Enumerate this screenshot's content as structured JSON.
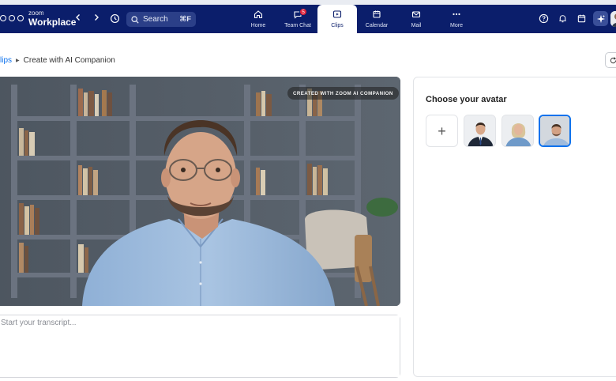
{
  "app": {
    "brand_small": "zoom",
    "brand_large": "Workplace"
  },
  "search": {
    "placeholder": "Search",
    "shortcut": "⌘F"
  },
  "nav_tabs": [
    {
      "label": "Home",
      "icon": "home-icon"
    },
    {
      "label": "Team Chat",
      "icon": "chat-icon",
      "badge": "5"
    },
    {
      "label": "Clips",
      "icon": "clips-icon",
      "active": true
    },
    {
      "label": "Calendar",
      "icon": "calendar-icon"
    },
    {
      "label": "Mail",
      "icon": "mail-icon"
    },
    {
      "label": "More",
      "icon": "more-icon"
    }
  ],
  "breadcrumb": {
    "parent": "Clips",
    "parent_visible": "lips",
    "current": "Create with AI Companion"
  },
  "video": {
    "watermark": "CREATED WITH ZOOM AI COMPANION"
  },
  "transcript": {
    "placeholder": "Start your transcript..."
  },
  "avatar_panel": {
    "title": "Choose your avatar",
    "options": [
      {
        "name": "add-avatar",
        "label": "+"
      },
      {
        "name": "avatar-man-suit"
      },
      {
        "name": "avatar-woman-blonde"
      },
      {
        "name": "avatar-man-glasses",
        "selected": true
      }
    ]
  },
  "colors": {
    "nav_bg": "#0b1e6b",
    "accent": "#0e72ed",
    "badge": "#e0223a"
  }
}
